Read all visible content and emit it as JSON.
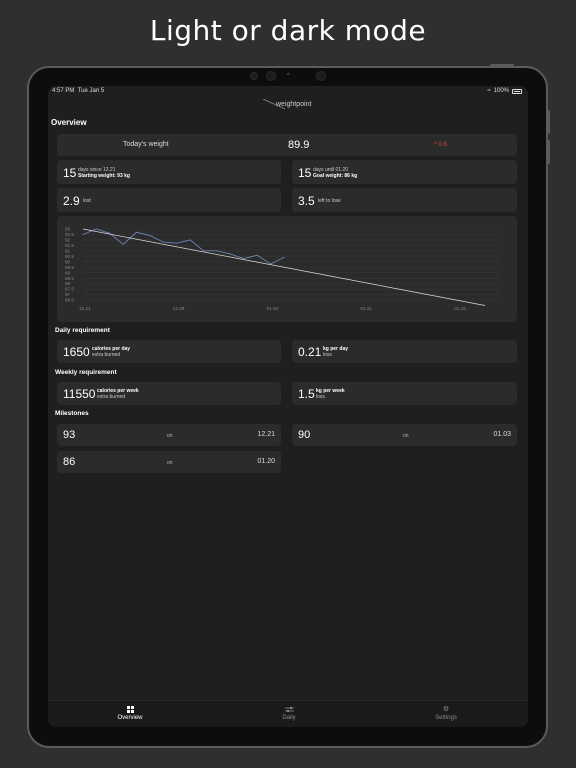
{
  "headline": "Light or dark mode",
  "status": {
    "time": "4:57 PM",
    "date": "Tue Jan 5",
    "battery": "100%"
  },
  "app": {
    "logo": "weightpoint",
    "overview_title": "Overview"
  },
  "today": {
    "label": "Today's weight",
    "value": "89.9",
    "change": "^ 0.6",
    "change_color": "#e0413a"
  },
  "stats": {
    "days_since": {
      "value": "15",
      "line1": "days since 12.21",
      "line2": "Starting weight: 93 kg"
    },
    "days_until": {
      "value": "15",
      "line1": "days until 01.20",
      "line2": "Goal weight: 86 kg"
    },
    "lost": {
      "value": "2.9",
      "label": "lost"
    },
    "left": {
      "value": "3.5",
      "label": "left to lose"
    }
  },
  "chart_data": {
    "type": "line",
    "y_ticks": [
      "93",
      "92.5",
      "92",
      "91.5",
      "91",
      "90.5",
      "90",
      "89.5",
      "89",
      "88.5",
      "88",
      "87.5",
      "87",
      "86.5"
    ],
    "x_ticks": [
      "12.21",
      "12.28",
      "01.04",
      "01.11",
      "01.18"
    ],
    "ylim": [
      86.5,
      93
    ],
    "series": [
      {
        "color": "#6f86b6",
        "x": [
          "12.21",
          "12.22",
          "12.23",
          "12.24",
          "12.25",
          "12.26",
          "12.27",
          "12.28",
          "12.29",
          "12.30",
          "12.31",
          "01.01",
          "01.02",
          "01.03",
          "01.04",
          "01.05"
        ],
        "values": [
          92.5,
          93.0,
          92.6,
          91.6,
          92.7,
          92.4,
          91.8,
          91.7,
          92.0,
          91.0,
          91.0,
          90.7,
          90.3,
          90.6,
          89.8,
          90.4
        ]
      },
      {
        "color": "#dddddd",
        "x": [
          "12.21",
          "01.20"
        ],
        "values": [
          93.0,
          86.0
        ]
      }
    ]
  },
  "daily": {
    "title": "Daily requirement",
    "calories": {
      "value": "1650",
      "line1": "calories per day",
      "line2": "extra burned"
    },
    "kg": {
      "value": "0.21",
      "line1": "kg per day",
      "line2": "loss"
    }
  },
  "weekly": {
    "title": "Weekly requirement",
    "calories": {
      "value": "11550",
      "line1": "calories per week",
      "line2": "extra burned"
    },
    "kg": {
      "value": "1.5",
      "line1": "kg per week",
      "line2": "loss"
    }
  },
  "milestones": {
    "title": "Milestones",
    "on_label": "on",
    "items": [
      {
        "weight": "93",
        "date": "12.21"
      },
      {
        "weight": "90",
        "date": "01.03"
      },
      {
        "weight": "86",
        "date": "01.20"
      }
    ]
  },
  "tabs": [
    {
      "label": "Overview",
      "icon": "grid-icon",
      "active": true
    },
    {
      "label": "Daily",
      "icon": "sliders-icon",
      "active": false
    },
    {
      "label": "Settings",
      "icon": "gear-icon",
      "active": false
    }
  ]
}
